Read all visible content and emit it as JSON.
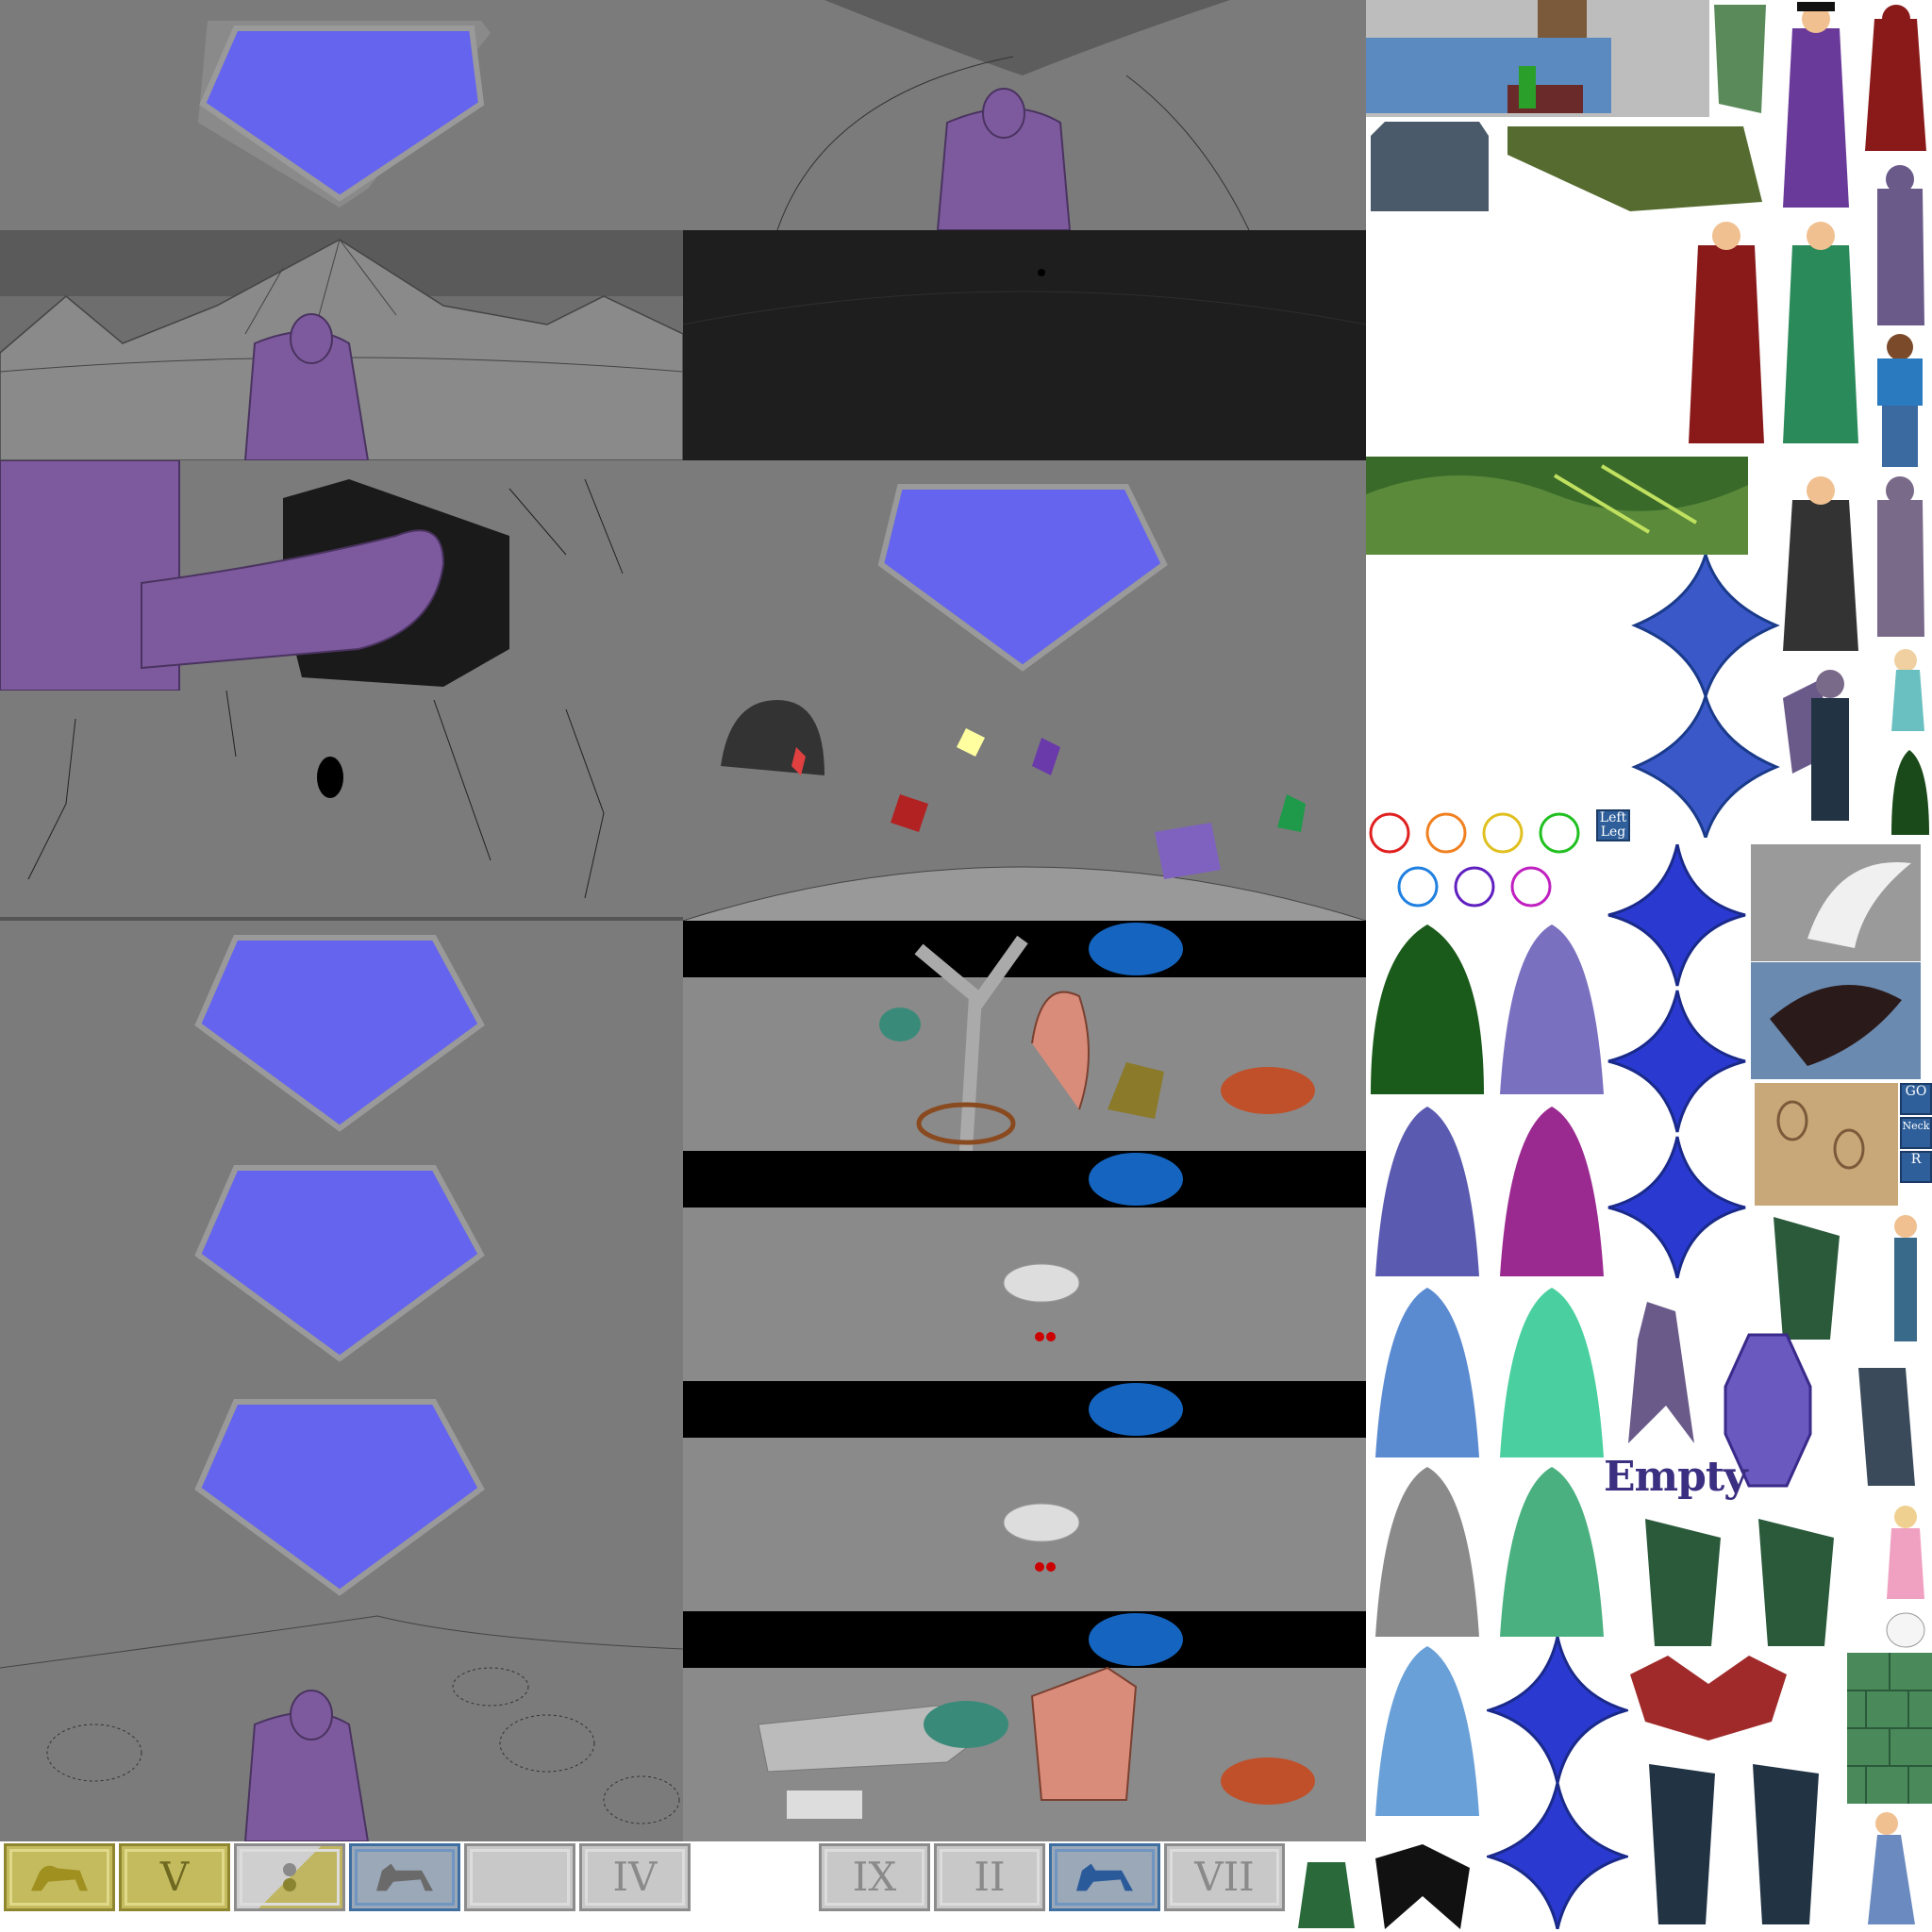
{
  "spritesheet": {
    "labels": {
      "empty": "Empty",
      "left_leg": "Left Leg",
      "go": "GO",
      "neck": "Neck",
      "r": "R"
    }
  },
  "chapter_buttons": [
    {
      "label": "",
      "icon": "lion-icon",
      "style": "gold"
    },
    {
      "label": "V",
      "icon": "",
      "style": "gold"
    },
    {
      "label": "",
      "icon": "yin-yang-icon",
      "style": "split"
    },
    {
      "label": "",
      "icon": "wolf-icon",
      "style": "blue"
    },
    {
      "label": "",
      "icon": "",
      "style": "plain"
    },
    {
      "label": "IV",
      "icon": "",
      "style": "plain"
    },
    {
      "label": "IX",
      "icon": "",
      "style": "plain"
    },
    {
      "label": "II",
      "icon": "",
      "style": "plain"
    },
    {
      "label": "",
      "icon": "wolf-icon",
      "style": "blue"
    },
    {
      "label": "VII",
      "icon": "",
      "style": "plain"
    }
  ],
  "colors": {
    "stone": "#7b7b7b",
    "gem": "#6464ee",
    "demon": "#7d5a9e",
    "night": "#000000",
    "portal": "#1565c0"
  }
}
